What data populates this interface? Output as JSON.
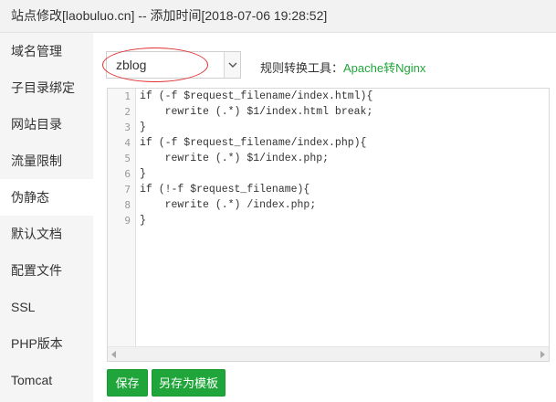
{
  "window": {
    "title": "站点修改[laobuluo.cn] -- 添加时间[2018-07-06 19:28:52]"
  },
  "sidebar": {
    "active_index": 4,
    "items": [
      {
        "label": "域名管理"
      },
      {
        "label": "子目录绑定"
      },
      {
        "label": "网站目录"
      },
      {
        "label": "流量限制"
      },
      {
        "label": "伪静态"
      },
      {
        "label": "默认文档"
      },
      {
        "label": "配置文件"
      },
      {
        "label": "SSL"
      },
      {
        "label": "PHP版本"
      },
      {
        "label": "Tomcat"
      }
    ]
  },
  "rewrite": {
    "template_select": {
      "value": "zblog",
      "icon": "chevron-down-icon"
    },
    "tool_label": "规则转换工具：",
    "tool_link": "Apache转Nginx",
    "editor": {
      "line_numbers": [
        "1",
        "2",
        "3",
        "4",
        "5",
        "6",
        "7",
        "8",
        "9"
      ],
      "lines": [
        "if (-f $request_filename/index.html){",
        "    rewrite (.*) $1/index.html break;",
        "}",
        "if (-f $request_filename/index.php){",
        "    rewrite (.*) $1/index.php;",
        "}",
        "if (!-f $request_filename){",
        "    rewrite (.*) /index.php;",
        "}"
      ]
    },
    "buttons": {
      "save": "保存",
      "save_as_template": "另存为模板"
    }
  },
  "colors": {
    "accent_green": "#20a53a",
    "highlight_red": "#e0302f",
    "sidebar_bg": "#f5f5f5"
  }
}
